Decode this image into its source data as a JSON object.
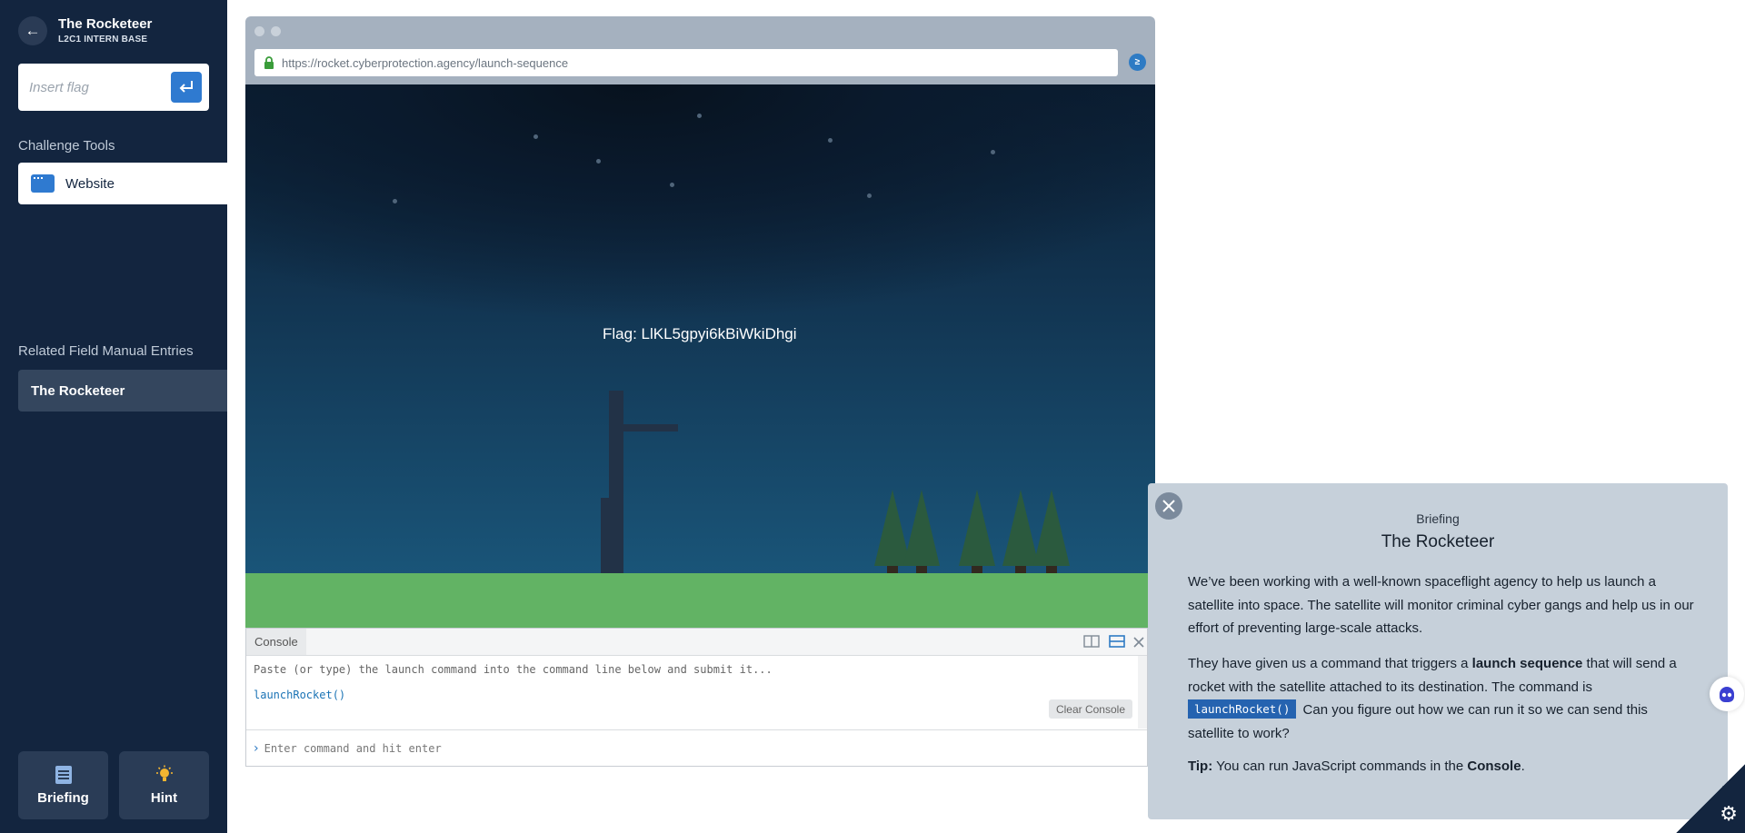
{
  "sidebar": {
    "title": "The Rocketeer",
    "subtitle": "L2C1 INTERN BASE",
    "flag_placeholder": "Insert flag",
    "tools_heading": "Challenge Tools",
    "tools": [
      {
        "label": "Website",
        "icon": "browser-window-icon"
      }
    ],
    "manual_heading": "Related Field Manual Entries",
    "manual_entries": [
      {
        "label": "The Rocketeer"
      }
    ],
    "bottom_buttons": [
      {
        "label": "Briefing",
        "icon": "document-icon"
      },
      {
        "label": "Hint",
        "icon": "lightbulb-icon"
      }
    ]
  },
  "browser": {
    "url": "https://rocket.cyberprotection.agency/launch-sequence",
    "flag_display": "Flag: LlKL5gpyi6kBiWkiDhgi"
  },
  "console": {
    "tab_label": "Console",
    "log_line": "Paste (or type) the launch command into the command line below and submit it...",
    "command_line": "launchRocket()",
    "clear_label": "Clear Console",
    "input_placeholder": "Enter command and hit enter"
  },
  "briefing": {
    "kicker": "Briefing",
    "title": "The Rocketeer",
    "para1": "We’ve been working with a well-known spaceflight agency to help us launch a satellite into space. The satellite will monitor criminal cyber gangs and help us in our effort of preventing large-scale attacks.",
    "para2_a": "They have given us a command that triggers a ",
    "para2_bold": "launch sequence",
    "para2_b": " that will send a rocket with the satellite attached to its destination. The command is ",
    "para2_code": "launchRocket()",
    "para2_c": " Can you figure out how we can run it so we can send this satellite to work?",
    "tip_label": "Tip:",
    "tip_text": " You can run JavaScript commands in the ",
    "tip_bold": "Console",
    "tip_end": "."
  },
  "colors": {
    "sidebar_bg": "#13253f",
    "accent": "#2f7ad0",
    "briefing_bg": "#c6d0da",
    "grass": "#62b364",
    "sky": "#123552"
  }
}
